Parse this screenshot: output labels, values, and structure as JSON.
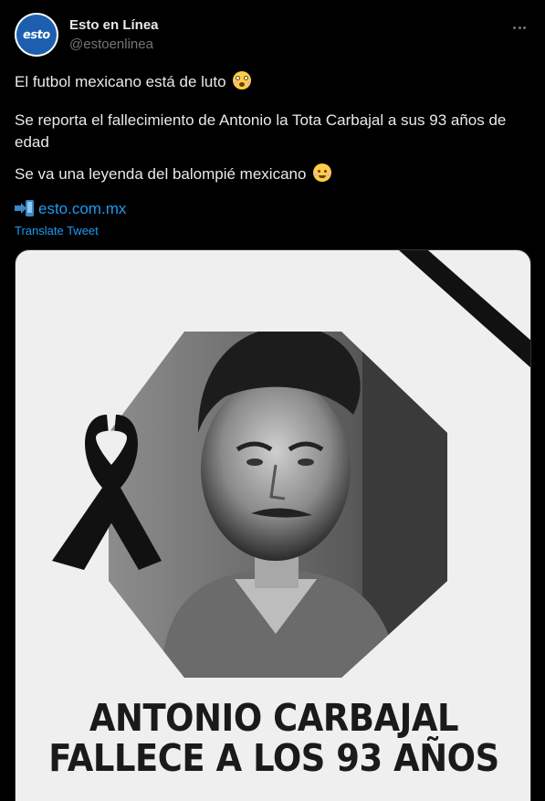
{
  "author": {
    "display_name": "Esto en Línea",
    "handle": "@estoenlinea",
    "avatar_text": "esto",
    "brand_color": "#1d5fae"
  },
  "tweet": {
    "line1": "El futbol mexicano está de luto",
    "line2": "Se reporta el fallecimiento de Antonio la Tota Carbajal a sus 93 años de edad",
    "line3": "Se va una leyenda del balompié mexicano",
    "emoji1": "flushed-face",
    "emoji2": "pleading-face",
    "link_icon": "mobile-phone-arrow-icon",
    "link": "esto.com.mx",
    "translate": "Translate Tweet"
  },
  "media": {
    "headline_line1": "ANTONIO CARBAJAL",
    "headline_line2": "FALLECE A LOS 93 AÑOS",
    "background": "#efefef"
  }
}
